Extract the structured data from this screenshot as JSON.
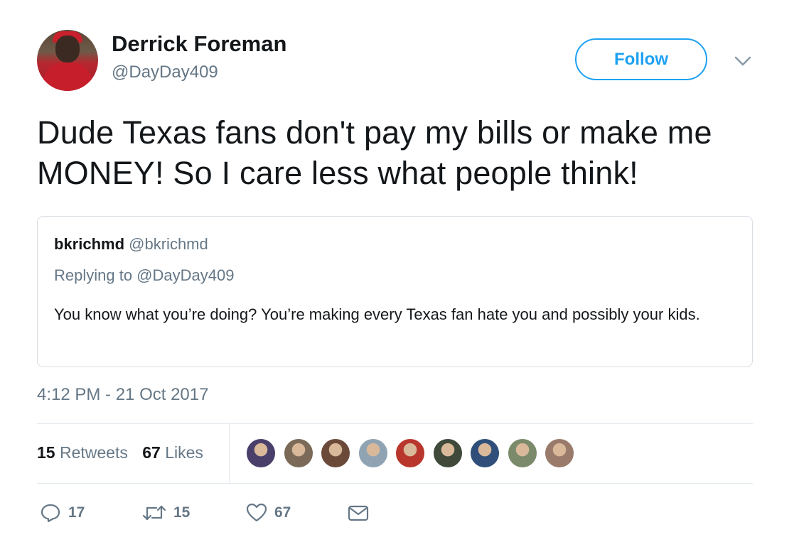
{
  "author": {
    "display_name": "Derrick Foreman",
    "handle": "@DayDay409",
    "avatar_icon": "profile-photo"
  },
  "follow_button": {
    "label": "Follow",
    "color": "#1da1f2"
  },
  "tweet": {
    "text": "Dude Texas fans don't pay my bills or make me MONEY! So I care less what people think!",
    "timestamp": "4:12 PM - 21 Oct 2017"
  },
  "quoted_tweet": {
    "display_name": "bkrichmd",
    "handle": "@bkrichmd",
    "replying_to": "Replying to @DayDay409",
    "text": "You know what you’re doing? You’re making every Texas fan hate you and possibly your kids."
  },
  "stats": {
    "retweets_count": "15",
    "retweets_label": "Retweets",
    "likes_count": "67",
    "likes_label": "Likes"
  },
  "likers": [
    {
      "color": "#4a3f6b"
    },
    {
      "color": "#7b6a58"
    },
    {
      "color": "#6b4a3a"
    },
    {
      "color": "#8fa3b3"
    },
    {
      "color": "#b8362c"
    },
    {
      "color": "#3f4a3a"
    },
    {
      "color": "#2f4f7a"
    },
    {
      "color": "#7a8a6a"
    },
    {
      "color": "#9a7a6a"
    }
  ],
  "actions": {
    "reply_count": "17",
    "retweet_count": "15",
    "like_count": "67"
  },
  "colors": {
    "text": "#14171a",
    "secondary": "#657786",
    "border": "#e1e8ed"
  }
}
